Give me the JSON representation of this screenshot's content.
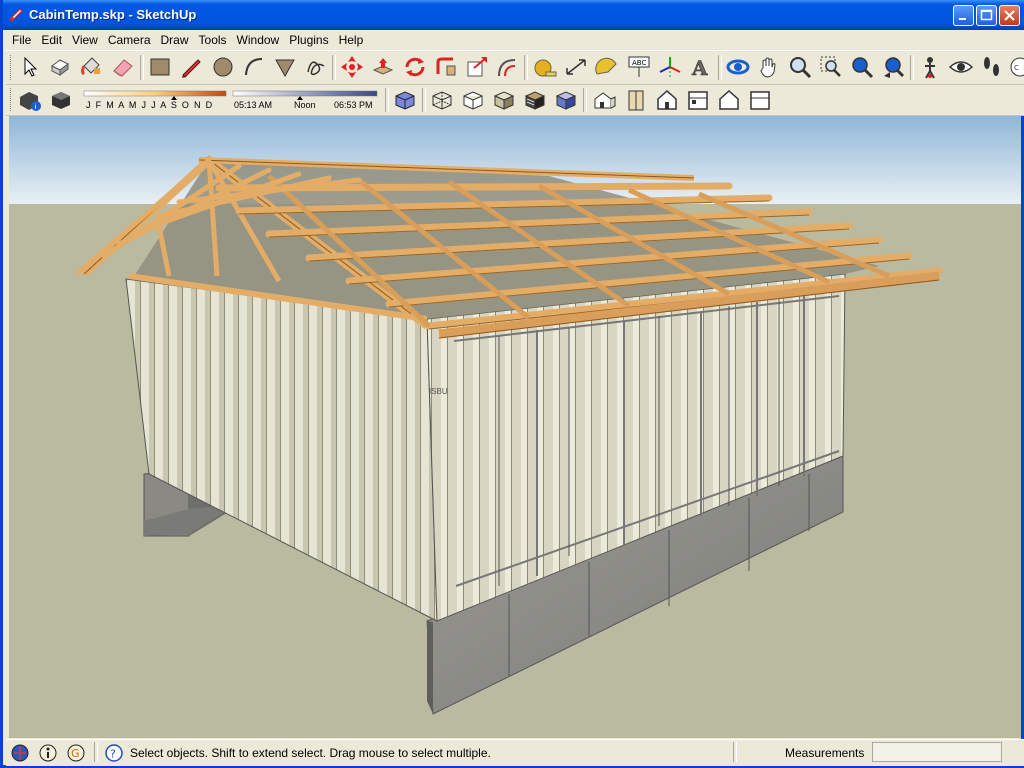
{
  "window": {
    "title": "CabinTemp.skp - SketchUp",
    "minimize_label": "_",
    "maximize_label": "□",
    "close_label": "✕"
  },
  "menu": [
    "File",
    "Edit",
    "View",
    "Camera",
    "Draw",
    "Tools",
    "Window",
    "Plugins",
    "Help"
  ],
  "toolbar_main": [
    "select-tool",
    "make-component-tool",
    "paint-bucket-tool",
    "eraser-tool",
    "rectangle-tool",
    "line-tool",
    "circle-tool",
    "arc-tool",
    "polygon-tool",
    "freehand-tool",
    "move-tool",
    "push-pull-tool",
    "rotate-tool",
    "follow-me-tool",
    "scale-tool",
    "offset-tool",
    "tape-measure-tool",
    "dimension-tool",
    "protractor-tool",
    "text-tool",
    "axes-tool",
    "3d-text-tool",
    "orbit-tool",
    "pan-tool",
    "zoom-tool",
    "zoom-window-tool",
    "zoom-extents-tool",
    "previous-view-tool",
    "position-camera-tool",
    "look-around-tool",
    "walk-tool",
    "section-plane-tool"
  ],
  "shadow_settings": {
    "months_label": "J F M A M J J A S O N D",
    "time_start": "05:13 AM",
    "time_mid": "Noon",
    "time_end": "06:53 PM"
  },
  "toolbar_styles": [
    "xray-icon",
    "back-edges-icon",
    "wireframe-icon",
    "hidden-line-icon",
    "shaded-icon",
    "shaded-textures-icon",
    "monochrome-icon"
  ],
  "toolbar_views": [
    "iso-view-icon",
    "top-view-icon",
    "front-view-icon",
    "right-view-icon",
    "back-view-icon",
    "left-view-icon"
  ],
  "status": {
    "message": "Select objects. Shift to extend select. Drag mouse to select multiple.",
    "measurements_label": "Measurements",
    "measurements_value": ""
  },
  "model": {
    "container_label": "ISBU"
  },
  "colors": {
    "sky_top": "#8fb6d8",
    "sky_bottom": "#e9f0f4",
    "ground": "#b9ba9f",
    "wood": "#e4ad67",
    "container": "#e6e4d2",
    "concrete": "#8f8f8a",
    "titlebar": "#0054e3"
  }
}
